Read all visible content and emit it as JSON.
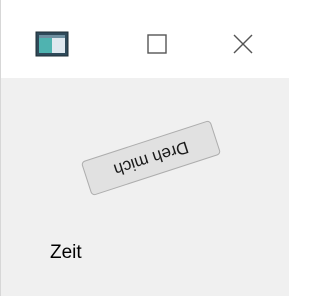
{
  "window": {
    "icon": "app-window-icon",
    "controls": {
      "maximize_icon": "square-icon",
      "close_icon": "x-icon"
    }
  },
  "content": {
    "button_label": "Dreh mich",
    "label_text": "Zeit"
  },
  "colors": {
    "titlebar_bg": "#ffffff",
    "client_bg": "#f0f0f0",
    "button_bg": "#e1e1e1",
    "button_border": "#adadad"
  }
}
